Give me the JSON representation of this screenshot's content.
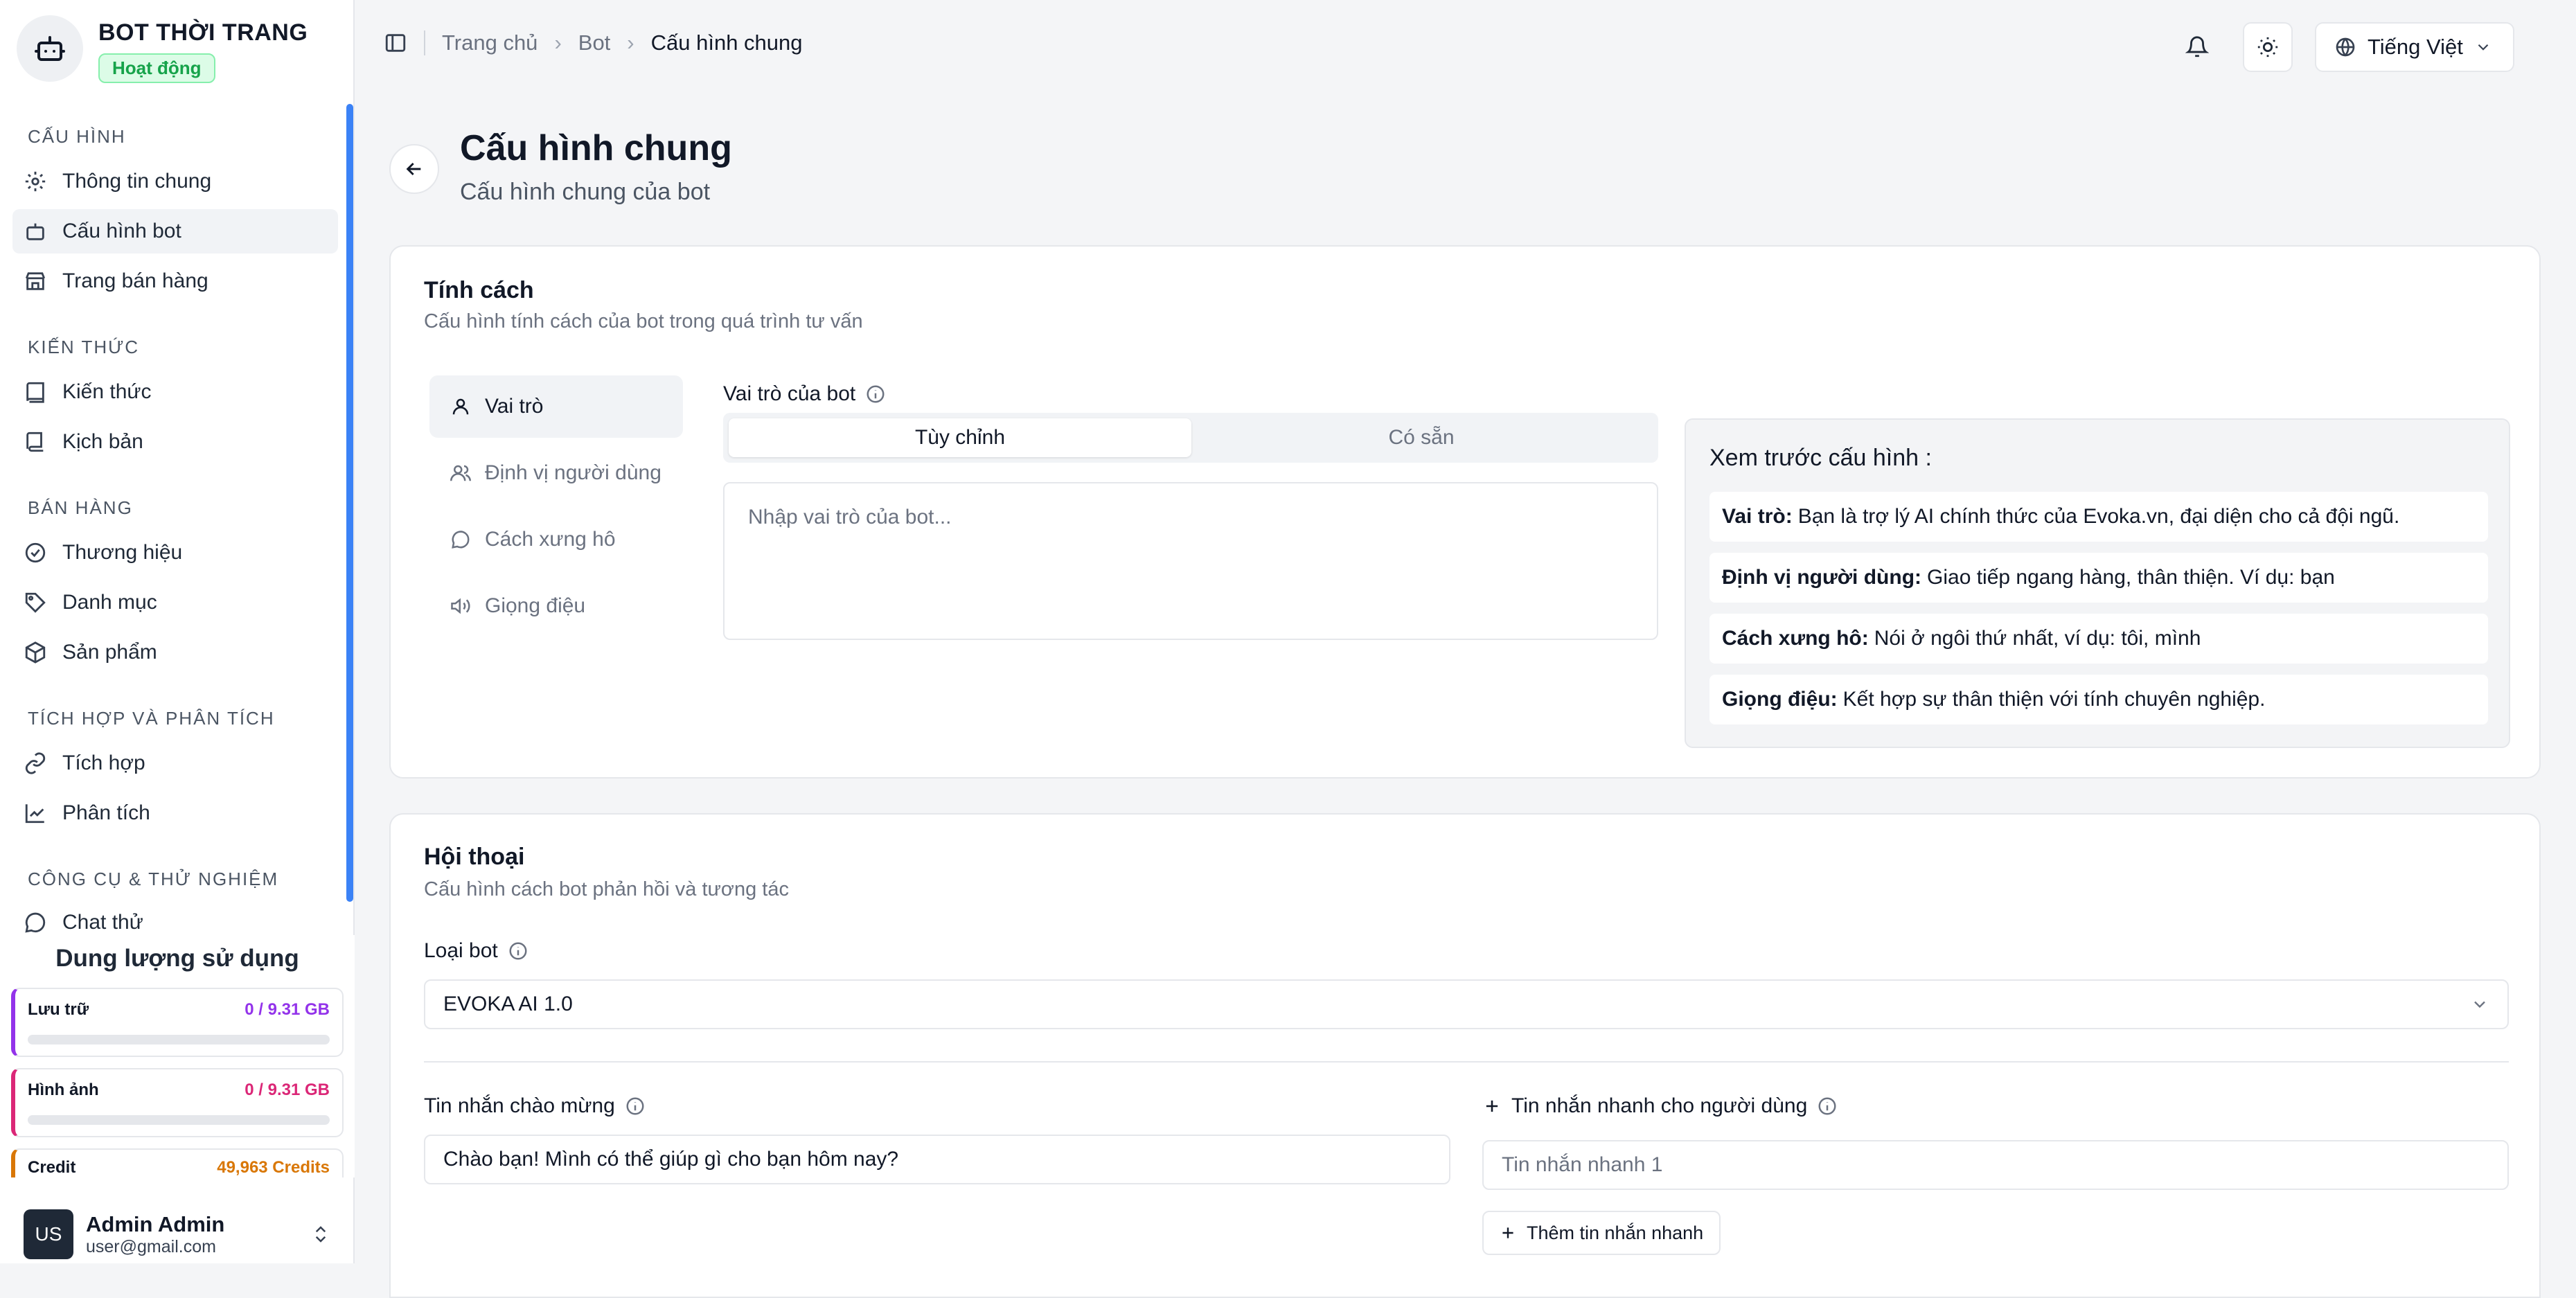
{
  "brand": {
    "name": "BOT THỜI TRANG",
    "status": "Hoạt động"
  },
  "sidebar": {
    "sections": [
      {
        "title": "CẤU HÌNH",
        "items": [
          {
            "label": "Thông tin chung",
            "icon": "gear-icon"
          },
          {
            "label": "Cấu hình bot",
            "icon": "bot-icon",
            "active": true
          },
          {
            "label": "Trang bán hàng",
            "icon": "store-icon"
          }
        ]
      },
      {
        "title": "KIẾN THỨC",
        "items": [
          {
            "label": "Kiến thức",
            "icon": "book-icon"
          },
          {
            "label": "Kịch bản",
            "icon": "script-icon"
          }
        ]
      },
      {
        "title": "BÁN HÀNG",
        "items": [
          {
            "label": "Thương hiệu",
            "icon": "badge-check-icon"
          },
          {
            "label": "Danh mục",
            "icon": "tag-icon"
          },
          {
            "label": "Sản phẩm",
            "icon": "box-icon"
          }
        ]
      },
      {
        "title": "TÍCH HỢP VÀ PHÂN TÍCH",
        "items": [
          {
            "label": "Tích hợp",
            "icon": "link-icon"
          },
          {
            "label": "Phân tích",
            "icon": "chart-line-icon"
          }
        ]
      },
      {
        "title": "CÔNG CỤ & THỬ NGHIỆM",
        "items": [
          {
            "label": "Chat thử",
            "icon": "chat-icon"
          }
        ]
      }
    ]
  },
  "usage": {
    "title": "Dung lượng sử dụng",
    "items": [
      {
        "label": "Lưu trữ",
        "value": "0 / 9.31 GB",
        "fraction": 0,
        "color": "#9333ea"
      },
      {
        "label": "Hình ảnh",
        "value": "0 / 9.31 GB",
        "fraction": 0,
        "color": "#db2777"
      },
      {
        "label": "Credit",
        "value": "49,963 Credits",
        "color": "#d97706"
      }
    ]
  },
  "user": {
    "initials": "US",
    "name": "Admin Admin",
    "email": "user@gmail.com"
  },
  "topbar": {
    "breadcrumb": [
      "Trang chủ",
      "Bot",
      "Cấu hình chung"
    ],
    "language": "Tiếng Việt"
  },
  "page": {
    "title": "Cấu hình chung",
    "subtitle": "Cấu hình chung của bot"
  },
  "personality": {
    "title": "Tính cách",
    "subtitle": "Cấu hình tính cách của bot trong quá trình tư vấn",
    "tabs": [
      {
        "label": "Vai trò",
        "icon": "user-icon",
        "active": true
      },
      {
        "label": "Định vị người dùng",
        "icon": "users-icon"
      },
      {
        "label": "Cách xưng hô",
        "icon": "message-circle-icon"
      },
      {
        "label": "Giọng điệu",
        "icon": "speaker-icon"
      }
    ],
    "role_label": "Vai trò của bot",
    "segment": [
      "Tùy chỉnh",
      "Có sẵn"
    ],
    "role_placeholder": "Nhập vai trò của bot...",
    "preview_title": "Xem trước cấu hình :",
    "preview": [
      {
        "key": "Vai trò:",
        "value": "Bạn là trợ lý AI chính thức của Evoka.vn, đại diện cho cả đội ngũ."
      },
      {
        "key": "Định vị người dùng:",
        "value": "Giao tiếp ngang hàng, thân thiện. Ví dụ: bạn"
      },
      {
        "key": "Cách xưng hô:",
        "value": "Nói ở ngôi thứ nhất, ví dụ: tôi, mình"
      },
      {
        "key": "Giọng điệu:",
        "value": "Kết hợp sự thân thiện với tính chuyên nghiệp."
      }
    ]
  },
  "conversation": {
    "title": "Hội thoại",
    "subtitle": "Cấu hình cách bot phản hồi và tương tác",
    "bot_type_label": "Loại bot",
    "bot_type_value": "EVOKA AI 1.0",
    "greeting_label": "Tin nhắn chào mừng",
    "greeting_value": "Chào bạn! Mình có thể giúp gì cho bạn hôm nay?",
    "quick_label": "Tin nhắn nhanh cho người dùng",
    "quick_placeholder": "Tin nhắn nhanh 1",
    "add_quick_label": "Thêm tin nhắn nhanh"
  }
}
